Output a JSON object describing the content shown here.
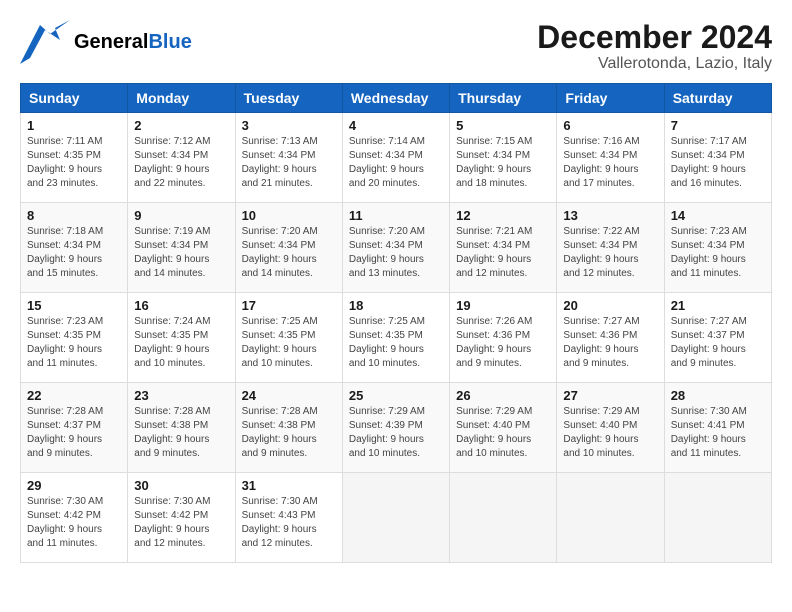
{
  "header": {
    "logo_general": "General",
    "logo_blue": "Blue",
    "month": "December 2024",
    "location": "Vallerotonda, Lazio, Italy"
  },
  "weekdays": [
    "Sunday",
    "Monday",
    "Tuesday",
    "Wednesday",
    "Thursday",
    "Friday",
    "Saturday"
  ],
  "weeks": [
    [
      {
        "day": "1",
        "sunrise": "7:11 AM",
        "sunset": "4:35 PM",
        "daylight": "9 hours and 23 minutes."
      },
      {
        "day": "2",
        "sunrise": "7:12 AM",
        "sunset": "4:34 PM",
        "daylight": "9 hours and 22 minutes."
      },
      {
        "day": "3",
        "sunrise": "7:13 AM",
        "sunset": "4:34 PM",
        "daylight": "9 hours and 21 minutes."
      },
      {
        "day": "4",
        "sunrise": "7:14 AM",
        "sunset": "4:34 PM",
        "daylight": "9 hours and 20 minutes."
      },
      {
        "day": "5",
        "sunrise": "7:15 AM",
        "sunset": "4:34 PM",
        "daylight": "9 hours and 18 minutes."
      },
      {
        "day": "6",
        "sunrise": "7:16 AM",
        "sunset": "4:34 PM",
        "daylight": "9 hours and 17 minutes."
      },
      {
        "day": "7",
        "sunrise": "7:17 AM",
        "sunset": "4:34 PM",
        "daylight": "9 hours and 16 minutes."
      }
    ],
    [
      {
        "day": "8",
        "sunrise": "7:18 AM",
        "sunset": "4:34 PM",
        "daylight": "9 hours and 15 minutes."
      },
      {
        "day": "9",
        "sunrise": "7:19 AM",
        "sunset": "4:34 PM",
        "daylight": "9 hours and 14 minutes."
      },
      {
        "day": "10",
        "sunrise": "7:20 AM",
        "sunset": "4:34 PM",
        "daylight": "9 hours and 14 minutes."
      },
      {
        "day": "11",
        "sunrise": "7:20 AM",
        "sunset": "4:34 PM",
        "daylight": "9 hours and 13 minutes."
      },
      {
        "day": "12",
        "sunrise": "7:21 AM",
        "sunset": "4:34 PM",
        "daylight": "9 hours and 12 minutes."
      },
      {
        "day": "13",
        "sunrise": "7:22 AM",
        "sunset": "4:34 PM",
        "daylight": "9 hours and 12 minutes."
      },
      {
        "day": "14",
        "sunrise": "7:23 AM",
        "sunset": "4:34 PM",
        "daylight": "9 hours and 11 minutes."
      }
    ],
    [
      {
        "day": "15",
        "sunrise": "7:23 AM",
        "sunset": "4:35 PM",
        "daylight": "9 hours and 11 minutes."
      },
      {
        "day": "16",
        "sunrise": "7:24 AM",
        "sunset": "4:35 PM",
        "daylight": "9 hours and 10 minutes."
      },
      {
        "day": "17",
        "sunrise": "7:25 AM",
        "sunset": "4:35 PM",
        "daylight": "9 hours and 10 minutes."
      },
      {
        "day": "18",
        "sunrise": "7:25 AM",
        "sunset": "4:35 PM",
        "daylight": "9 hours and 10 minutes."
      },
      {
        "day": "19",
        "sunrise": "7:26 AM",
        "sunset": "4:36 PM",
        "daylight": "9 hours and 9 minutes."
      },
      {
        "day": "20",
        "sunrise": "7:27 AM",
        "sunset": "4:36 PM",
        "daylight": "9 hours and 9 minutes."
      },
      {
        "day": "21",
        "sunrise": "7:27 AM",
        "sunset": "4:37 PM",
        "daylight": "9 hours and 9 minutes."
      }
    ],
    [
      {
        "day": "22",
        "sunrise": "7:28 AM",
        "sunset": "4:37 PM",
        "daylight": "9 hours and 9 minutes."
      },
      {
        "day": "23",
        "sunrise": "7:28 AM",
        "sunset": "4:38 PM",
        "daylight": "9 hours and 9 minutes."
      },
      {
        "day": "24",
        "sunrise": "7:28 AM",
        "sunset": "4:38 PM",
        "daylight": "9 hours and 9 minutes."
      },
      {
        "day": "25",
        "sunrise": "7:29 AM",
        "sunset": "4:39 PM",
        "daylight": "9 hours and 10 minutes."
      },
      {
        "day": "26",
        "sunrise": "7:29 AM",
        "sunset": "4:40 PM",
        "daylight": "9 hours and 10 minutes."
      },
      {
        "day": "27",
        "sunrise": "7:29 AM",
        "sunset": "4:40 PM",
        "daylight": "9 hours and 10 minutes."
      },
      {
        "day": "28",
        "sunrise": "7:30 AM",
        "sunset": "4:41 PM",
        "daylight": "9 hours and 11 minutes."
      }
    ],
    [
      {
        "day": "29",
        "sunrise": "7:30 AM",
        "sunset": "4:42 PM",
        "daylight": "9 hours and 11 minutes."
      },
      {
        "day": "30",
        "sunrise": "7:30 AM",
        "sunset": "4:42 PM",
        "daylight": "9 hours and 12 minutes."
      },
      {
        "day": "31",
        "sunrise": "7:30 AM",
        "sunset": "4:43 PM",
        "daylight": "9 hours and 12 minutes."
      },
      null,
      null,
      null,
      null
    ]
  ],
  "labels": {
    "sunrise": "Sunrise:",
    "sunset": "Sunset:",
    "daylight": "Daylight:"
  }
}
